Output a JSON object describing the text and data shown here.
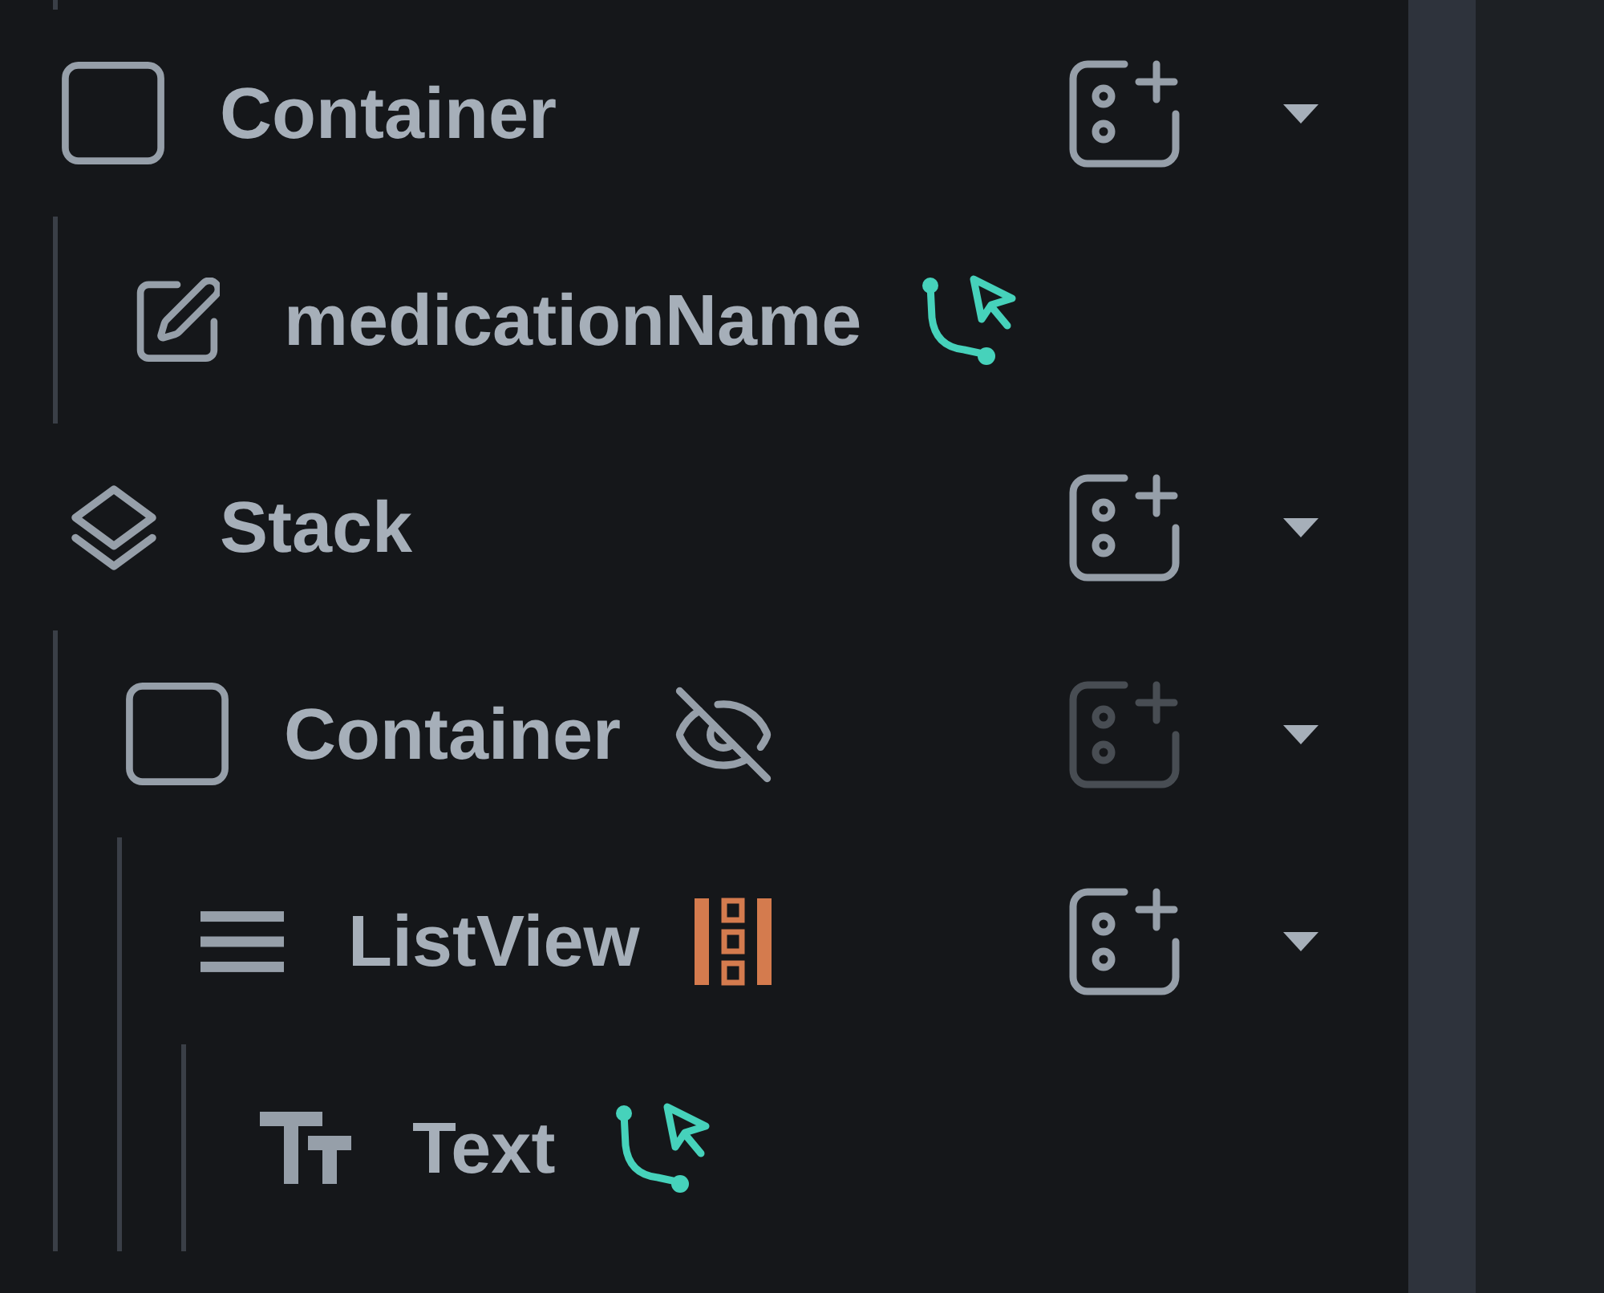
{
  "widget_tree": {
    "nodes": [
      {
        "kind": "container",
        "label": "Container",
        "has_binding": false,
        "hidden": false,
        "generated_children": false,
        "add_button": {
          "disabled": false
        },
        "children": [
          {
            "kind": "text_field",
            "label": "medicationName",
            "has_binding": true,
            "hidden": false,
            "generated_children": false
          }
        ]
      },
      {
        "kind": "stack",
        "label": "Stack",
        "has_binding": false,
        "hidden": false,
        "generated_children": false,
        "add_button": {
          "disabled": false
        },
        "children": [
          {
            "kind": "container",
            "label": "Container",
            "has_binding": false,
            "hidden": true,
            "generated_children": false,
            "add_button": {
              "disabled": true
            },
            "children": [
              {
                "kind": "list_view",
                "label": "ListView",
                "has_binding": false,
                "hidden": false,
                "generated_children": true,
                "add_button": {
                  "disabled": false
                },
                "children": [
                  {
                    "kind": "text",
                    "label": "Text",
                    "has_binding": true,
                    "hidden": false,
                    "generated_children": false
                  }
                ]
              }
            ]
          }
        ]
      }
    ]
  }
}
